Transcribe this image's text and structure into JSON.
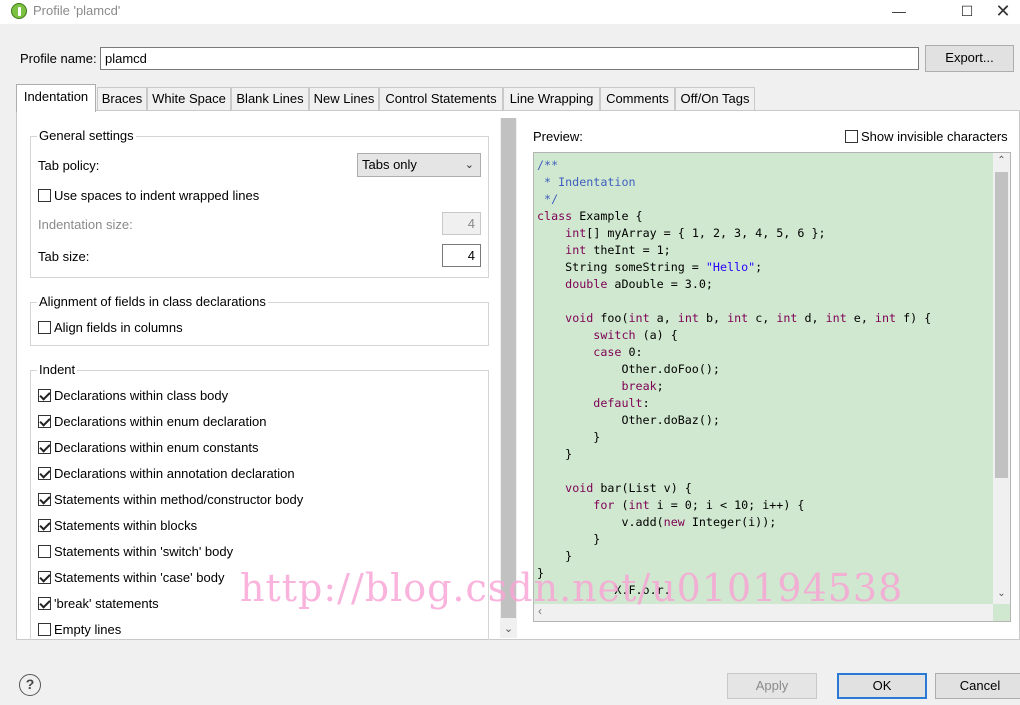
{
  "window": {
    "title": "Profile 'plamcd'",
    "icons": [
      "app-icon",
      "minimize-icon",
      "maximize-icon",
      "close-icon"
    ]
  },
  "profile": {
    "label": "Profile name:",
    "value": "plamcd",
    "export_label": "Export..."
  },
  "tabs": [
    {
      "label": "Indentation",
      "active": true
    },
    {
      "label": "Braces"
    },
    {
      "label": "White Space"
    },
    {
      "label": "Blank Lines"
    },
    {
      "label": "New Lines"
    },
    {
      "label": "Control Statements"
    },
    {
      "label": "Line Wrapping"
    },
    {
      "label": "Comments"
    },
    {
      "label": "Off/On Tags"
    }
  ],
  "general": {
    "title": "General settings",
    "tab_policy_label": "Tab policy:",
    "tab_policy_value": "Tabs only",
    "use_spaces_label": "Use spaces to indent wrapped lines",
    "use_spaces_checked": false,
    "indentation_size_label": "Indentation size:",
    "indentation_size_value": "4",
    "tab_size_label": "Tab size:",
    "tab_size_value": "4"
  },
  "alignment": {
    "title": "Alignment of fields in class declarations",
    "align_label": "Align fields in columns",
    "align_checked": false
  },
  "indent": {
    "title": "Indent",
    "items": [
      {
        "label": "Declarations within class body",
        "checked": true
      },
      {
        "label": "Declarations within enum declaration",
        "checked": true
      },
      {
        "label": "Declarations within enum constants",
        "checked": true
      },
      {
        "label": "Declarations within annotation declaration",
        "checked": true
      },
      {
        "label": "Statements within method/constructor body",
        "checked": true
      },
      {
        "label": "Statements within blocks",
        "checked": true
      },
      {
        "label": "Statements within 'switch' body",
        "checked": false
      },
      {
        "label": "Statements within 'case' body",
        "checked": true
      },
      {
        "label": "'break' statements",
        "checked": true
      },
      {
        "label": "Empty lines",
        "checked": false
      }
    ]
  },
  "preview": {
    "label": "Preview:",
    "show_invisible_label": "Show invisible characters",
    "show_invisible_checked": false,
    "code_lines": [
      [
        [
          "cm",
          "/**"
        ]
      ],
      [
        [
          "cm",
          " * Indentation"
        ]
      ],
      [
        [
          "cm",
          " */"
        ]
      ],
      [
        [
          "kw",
          "class"
        ],
        [
          "",
          " Example {"
        ]
      ],
      [
        [
          "",
          "    "
        ],
        [
          "kw",
          "int"
        ],
        [
          "",
          "[] myArray = { 1, 2, 3, 4, 5, 6 };"
        ]
      ],
      [
        [
          "",
          "    "
        ],
        [
          "kw",
          "int"
        ],
        [
          "",
          " theInt = 1;"
        ]
      ],
      [
        [
          "",
          "    String someString = "
        ],
        [
          "st",
          "\"Hello\""
        ],
        [
          "",
          ";"
        ]
      ],
      [
        [
          "",
          "    "
        ],
        [
          "kw",
          "double"
        ],
        [
          "",
          " aDouble = 3.0;"
        ]
      ],
      [
        [
          "",
          ""
        ]
      ],
      [
        [
          "",
          "    "
        ],
        [
          "kw",
          "void"
        ],
        [
          "",
          " foo("
        ],
        [
          "kw",
          "int"
        ],
        [
          "",
          " a, "
        ],
        [
          "kw",
          "int"
        ],
        [
          "",
          " b, "
        ],
        [
          "kw",
          "int"
        ],
        [
          "",
          " c, "
        ],
        [
          "kw",
          "int"
        ],
        [
          "",
          " d, "
        ],
        [
          "kw",
          "int"
        ],
        [
          "",
          " e, "
        ],
        [
          "kw",
          "int"
        ],
        [
          "",
          " f) {"
        ]
      ],
      [
        [
          "",
          "        "
        ],
        [
          "kw",
          "switch"
        ],
        [
          "",
          " (a) {"
        ]
      ],
      [
        [
          "",
          "        "
        ],
        [
          "kw",
          "case"
        ],
        [
          "",
          " 0:"
        ]
      ],
      [
        [
          "",
          "            Other.doFoo();"
        ]
      ],
      [
        [
          "",
          "            "
        ],
        [
          "kw",
          "break"
        ],
        [
          "",
          ";"
        ]
      ],
      [
        [
          "",
          "        "
        ],
        [
          "kw",
          "default"
        ],
        [
          "",
          ":"
        ]
      ],
      [
        [
          "",
          "            Other.doBaz();"
        ]
      ],
      [
        [
          "",
          "        }"
        ]
      ],
      [
        [
          "",
          "    }"
        ]
      ],
      [
        [
          "",
          ""
        ]
      ],
      [
        [
          "",
          "    "
        ],
        [
          "kw",
          "void"
        ],
        [
          "",
          " bar(List v) {"
        ]
      ],
      [
        [
          "",
          "        "
        ],
        [
          "kw",
          "for"
        ],
        [
          "",
          " ("
        ],
        [
          "kw",
          "int"
        ],
        [
          "",
          " i = 0; i < 10; i++) {"
        ]
      ],
      [
        [
          "",
          "            v.add("
        ],
        [
          "kw",
          "new"
        ],
        [
          "",
          " Integer(i));"
        ]
      ],
      [
        [
          "",
          "        }"
        ]
      ],
      [
        [
          "",
          "    }"
        ]
      ],
      [
        [
          "",
          "}"
        ]
      ],
      [
        [
          "",
          "           X.F.o.r."
        ]
      ]
    ]
  },
  "watermark": "http://blog.csdn.net/u010194538",
  "buttons": {
    "apply": "Apply",
    "ok": "OK",
    "cancel": "Cancel",
    "help": "?"
  }
}
